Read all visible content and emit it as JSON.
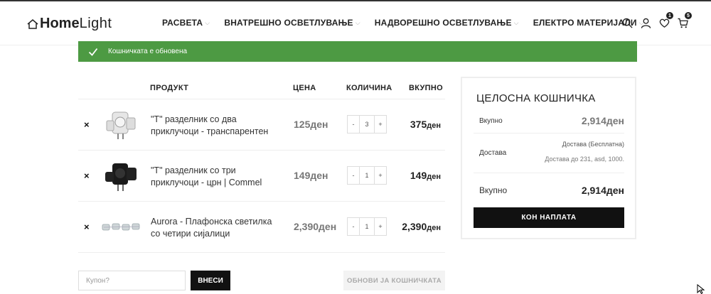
{
  "header": {
    "logo_home": "Home",
    "logo_light": "Light",
    "nav": [
      {
        "label": "РАСВЕТА"
      },
      {
        "label": "ВНАТРЕШНО ОСВЕТЛУВАЊЕ"
      },
      {
        "label": "НАДВОРЕШНО ОСВЕТЛУВАЊЕ"
      },
      {
        "label": "ЕЛЕКТРО МАТЕРИЈАЛИ"
      }
    ],
    "wishlist_count": "1",
    "cart_count": "5"
  },
  "notice": {
    "message": "Кошничката е обновена"
  },
  "cart": {
    "headers": {
      "product": "ПРОДУКТ",
      "price": "ЦЕНА",
      "quantity": "КОЛИЧИНА",
      "total": "ВКУПНО"
    },
    "remove_symbol": "×",
    "items": [
      {
        "name": "\"T\" разделник со два приклучоци - транспарентен",
        "price": "125",
        "currency": "ден",
        "qty": "3",
        "subtotal": "375"
      },
      {
        "name": "\"T\" разделник со три приклучоци - црн | Commel",
        "price": "149",
        "currency": "ден",
        "qty": "1",
        "subtotal": "149"
      },
      {
        "name": "Aurora - Плафонска светилка со четири сијалици",
        "price": "2,390",
        "currency": "ден",
        "qty": "1",
        "subtotal": "2,390"
      }
    ],
    "qty_minus": "-",
    "qty_plus": "+",
    "coupon_placeholder": "Купон?",
    "coupon_button": "ВНЕСИ",
    "update_button": "ОБНОВИ ЈА КОШНИЧКАТА"
  },
  "totals": {
    "title": "ЦЕЛОСНА КОШНИЧКА",
    "subtotal_label": "Вкупно",
    "subtotal_value": "2,914ден",
    "shipping_label": "Достава",
    "shipping_method": "Достава (Бесплатна)",
    "shipping_to": "Достава до 231, asd, 1000.",
    "total_label": "Вкупно",
    "total_value": "2,914ден",
    "checkout_button": "КОН НАПЛАТА"
  },
  "colors": {
    "accent_green": "#4d9a43",
    "dark": "#111111"
  }
}
